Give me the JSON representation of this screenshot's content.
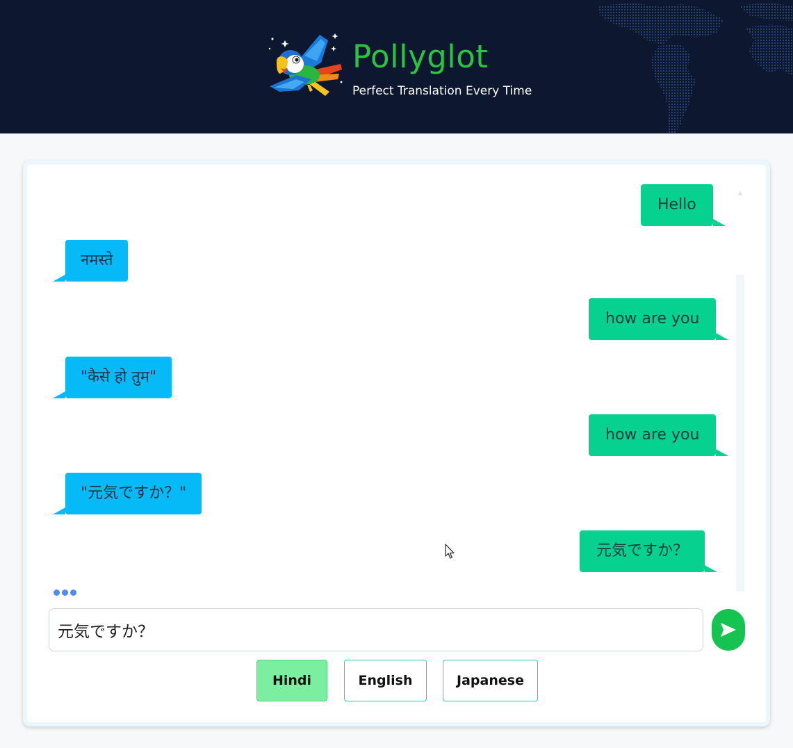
{
  "header": {
    "title": "Pollyglot",
    "tagline": "Perfect Translation Every Time",
    "logo_icon": "parrot-icon",
    "background_icon": "world-map-dots"
  },
  "chat": {
    "messages": [
      {
        "role": "user",
        "text": "Hello"
      },
      {
        "role": "bot",
        "text": "नमस्ते"
      },
      {
        "role": "user",
        "text": "how are you"
      },
      {
        "role": "bot",
        "text": "\"कैसे हो तुम\""
      },
      {
        "role": "user",
        "text": "how are you"
      },
      {
        "role": "bot",
        "text": "\"元気ですか？\""
      },
      {
        "role": "user",
        "text": "元気ですか？"
      }
    ],
    "typing_indicator": "loading-dots-icon"
  },
  "input": {
    "value": "元気ですか？",
    "send_icon": "send-arrow-icon"
  },
  "languages": {
    "options": [
      "Hindi",
      "English",
      "Japanese"
    ],
    "selected": "Hindi"
  },
  "colors": {
    "header_bg": "#0d1830",
    "brand_green": "#2bc33f",
    "user_bubble": "#06d18f",
    "bot_bubble": "#06b9f7",
    "send_button": "#15c450",
    "selected_language": "#7bef9f",
    "language_border": "#22d49b"
  }
}
